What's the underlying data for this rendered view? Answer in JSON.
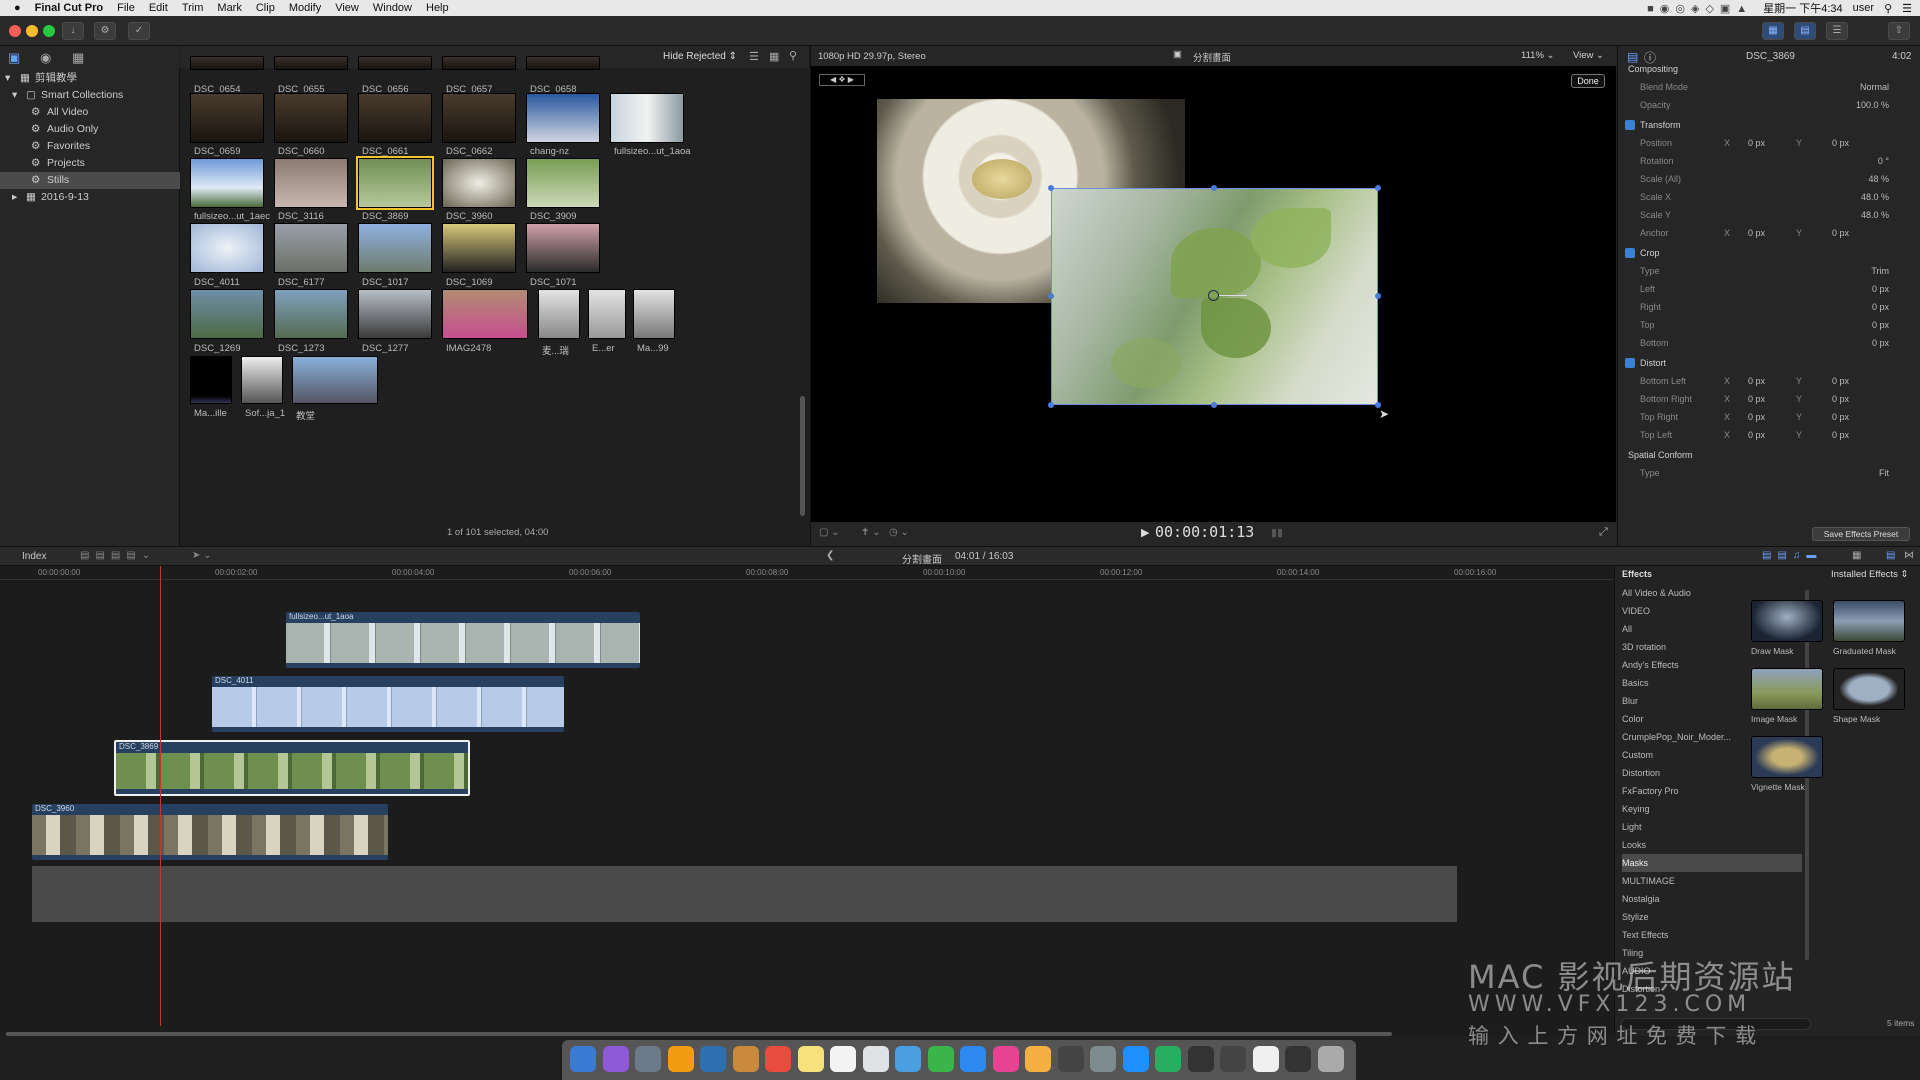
{
  "menubar": {
    "apple": "",
    "app_name": "Final Cut Pro",
    "items": [
      "File",
      "Edit",
      "Trim",
      "Mark",
      "Clip",
      "Modify",
      "View",
      "Window",
      "Help"
    ],
    "clock": "星期一 下午4:34",
    "user": "user"
  },
  "library": {
    "name": "剪辑教學",
    "smart_collections_label": "Smart Collections",
    "items": [
      "All Video",
      "Audio Only",
      "Favorites",
      "Projects",
      "Stills"
    ],
    "event": "2016-9-13"
  },
  "browser": {
    "filter": "Hide Rejected",
    "status": "1 of 101 selected, 04:00",
    "clips": [
      "DSC_0654",
      "DSC_0655",
      "DSC_0656",
      "DSC_0657",
      "DSC_0658",
      "DSC_0659",
      "DSC_0660",
      "DSC_0661",
      "DSC_0662",
      "chang-nz",
      "fullsizeo...ut_1aoa",
      "fullsizeo...ut_1aec",
      "DSC_3116",
      "DSC_3869",
      "DSC_3960",
      "DSC_3909",
      "DSC_4011",
      "DSC_6177",
      "DSC_1017",
      "DSC_1069",
      "DSC_1071",
      "DSC_1269",
      "DSC_1273",
      "DSC_1277",
      "IMAG2478",
      "麦...瑞",
      "E...er",
      "Ma...99",
      "Ma...ille",
      "Sof...ja_1",
      "教堂"
    ]
  },
  "viewer": {
    "format": "1080p HD 29.97p, Stereo",
    "project": "分割畫面",
    "zoom": "111%",
    "view_label": "View",
    "done_label": "Done",
    "timecode": "00:00:01:13"
  },
  "inspector": {
    "clip_name": "DSC_3869",
    "duration": "4:02",
    "rows": [
      {
        "label": "Compositing",
        "kind": "section"
      },
      {
        "label": "Blend Mode",
        "value": "Normal"
      },
      {
        "label": "Opacity",
        "value": "100.0 %"
      },
      {
        "label": "Transform",
        "kind": "check"
      },
      {
        "label": "Position",
        "x": "0 px",
        "y": "0 px"
      },
      {
        "label": "Rotation",
        "value": "0 °"
      },
      {
        "label": "Scale (All)",
        "value": "48 %"
      },
      {
        "label": "Scale X",
        "value": "48.0 %"
      },
      {
        "label": "Scale Y",
        "value": "48.0 %"
      },
      {
        "label": "Anchor",
        "x": "0 px",
        "y": "0 px"
      },
      {
        "label": "Crop",
        "kind": "check"
      },
      {
        "label": "Type",
        "value": "Trim"
      },
      {
        "label": "Left",
        "value": "0 px"
      },
      {
        "label": "Right",
        "value": "0 px"
      },
      {
        "label": "Top",
        "value": "0 px"
      },
      {
        "label": "Bottom",
        "value": "0 px"
      },
      {
        "label": "Distort",
        "kind": "check"
      },
      {
        "label": "Bottom Left",
        "x": "0 px",
        "y": "0 px"
      },
      {
        "label": "Bottom Right",
        "x": "0 px",
        "y": "0 px"
      },
      {
        "label": "Top Right",
        "x": "0 px",
        "y": "0 px"
      },
      {
        "label": "Top Left",
        "x": "0 px",
        "y": "0 px"
      },
      {
        "label": "Spatial Conform",
        "kind": "section"
      },
      {
        "label": "Type",
        "value": "Fit"
      }
    ],
    "save_preset": "Save Effects Preset"
  },
  "timeline_bar": {
    "index": "Index",
    "project": "分割畫面",
    "position": "04:01 / 16:03",
    "ruler": [
      "00:00:00:00",
      "00:00:02:00",
      "00:00:04:00",
      "00:00:06:00",
      "00:00:08:00",
      "00:00:10:00",
      "00:00:12:00",
      "00:00:14:00",
      "00:00:16:00"
    ]
  },
  "timeline_clips": [
    "fullsizeo...ut_1aoa",
    "DSC_4011",
    "DSC_3869",
    "DSC_3960"
  ],
  "effects": {
    "header": "Effects",
    "installed": "Installed Effects",
    "categories": [
      "All Video & Audio",
      "VIDEO",
      "All",
      "3D rotation",
      "Andy's Effects",
      "Basics",
      "Blur",
      "Color",
      "CrumplePop_Noir_Moder...",
      "Custom",
      "Distortion",
      "FxFactory Pro",
      "Keying",
      "Light",
      "Looks",
      "Masks",
      "MULTIMAGE",
      "Nostalgia",
      "Stylize",
      "Text Effects",
      "Tiling",
      "AUDIO",
      "Distortion"
    ],
    "selected": "Masks",
    "tiles": [
      "Draw Mask",
      "Graduated Mask",
      "Image Mask",
      "Shape Mask",
      "Vignette Mask"
    ],
    "count": "5 items"
  },
  "watermark": {
    "line1": "MAC 影视后期资源站",
    "line2": "WWW.VFX123.COM",
    "line3": "输 入 上 方 网 址  免 费 下 载"
  },
  "colors": {
    "accent": "#3b7fd6",
    "clip_blue": "#27405f",
    "playhead": "#c0392b"
  }
}
